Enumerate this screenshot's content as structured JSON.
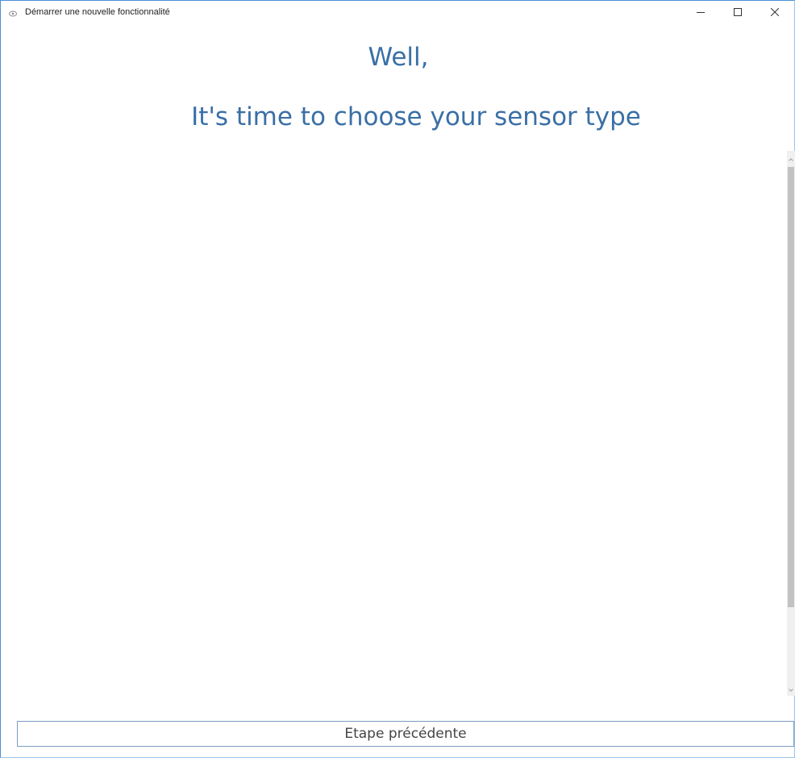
{
  "window": {
    "title": "Démarrer une nouvelle fonctionnalité",
    "app_icon": "app-icon",
    "controls": {
      "minimize_icon": "minimize-icon",
      "maximize_icon": "maximize-icon",
      "close_icon": "close-icon"
    }
  },
  "main": {
    "heading": "Well,",
    "subheading": "It's time to choose your sensor type"
  },
  "footer": {
    "previous_step_label": "Etape précédente"
  },
  "colors": {
    "heading": "#3a6fa6",
    "border_accent": "#4a90d9"
  }
}
